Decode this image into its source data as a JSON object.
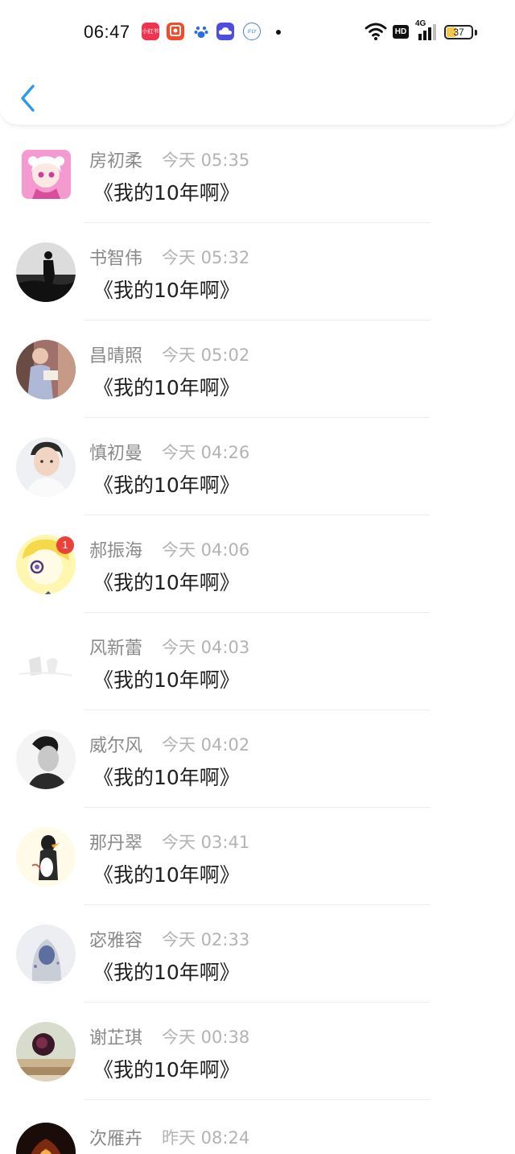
{
  "status_bar": {
    "time": "06:47",
    "network": "4G",
    "hd": "HD",
    "battery": "37",
    "battery_level": 0.37,
    "app_icons": [
      "red-app-icon",
      "orange-app-icon",
      "baidu-paw-icon",
      "cloud-app-icon",
      "ifly-icon"
    ],
    "icon_texts": [
      "小红书",
      "",
      "",
      "",
      "iFLY"
    ]
  },
  "header": {
    "back_icon": "chevron-left-icon",
    "accent": "#2d9be8"
  },
  "items": [
    {
      "name": "房初柔",
      "time": "今天 05:35",
      "message": "《我的10年啊》",
      "avatar": "anime-girl-avatar"
    },
    {
      "name": "书智伟",
      "time": "今天 05:32",
      "message": "《我的10年啊》",
      "avatar": "silhouette-avatar"
    },
    {
      "name": "昌晴照",
      "time": "今天 05:02",
      "message": "《我的10年啊》",
      "avatar": "reading-girl-avatar"
    },
    {
      "name": "慎初曼",
      "time": "今天 04:26",
      "message": "《我的10年啊》",
      "avatar": "young-man-avatar"
    },
    {
      "name": "郝振海",
      "time": "今天 04:06",
      "message": "《我的10年啊》",
      "avatar": "cartoon-avatar",
      "badge": "1"
    },
    {
      "name": "风新蕾",
      "time": "今天 04:03",
      "message": "《我的10年啊》",
      "avatar": "pale-sketch-avatar"
    },
    {
      "name": "威尔风",
      "time": "今天 04:02",
      "message": "《我的10年啊》",
      "avatar": "bw-portrait-avatar"
    },
    {
      "name": "那丹翠",
      "time": "今天 03:41",
      "message": "《我的10年啊》",
      "avatar": "penguin-avatar"
    },
    {
      "name": "宓雅容",
      "time": "今天 02:33",
      "message": "《我的10年啊》",
      "avatar": "hooded-figure-avatar"
    },
    {
      "name": "谢芷琪",
      "time": "今天 00:38",
      "message": "《我的10年啊》",
      "avatar": "rose-books-avatar"
    },
    {
      "name": "次雁卉",
      "time": "昨天 08:24",
      "message": "",
      "avatar": "dark-fire-avatar"
    }
  ]
}
